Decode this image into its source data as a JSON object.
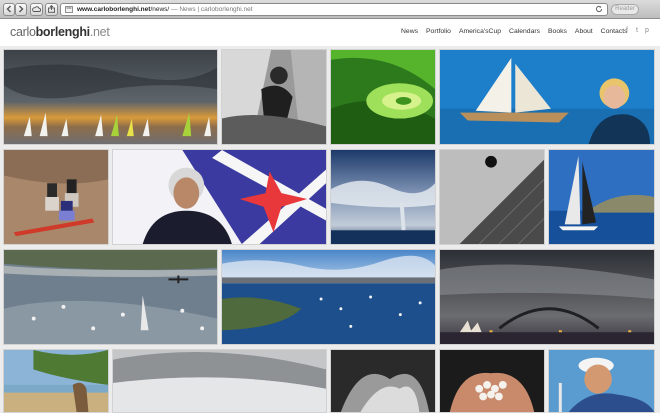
{
  "browser": {
    "url_host": "www.carloborlenghi.net",
    "url_path": "/news/",
    "url_title": " — News | carloborlenghi.net",
    "reader_label": "Reader"
  },
  "site": {
    "logo_light": "carlo",
    "logo_bold": "borlenghi",
    "logo_tld": ".net",
    "nav": [
      "News",
      "Portfolio",
      "America'sCup",
      "Calendars",
      "Books",
      "About",
      "Contacts"
    ],
    "social": [
      "f",
      "t",
      "p"
    ]
  },
  "icons": [
    "back-arrow-icon",
    "forward-arrow-icon",
    "cloud-icon",
    "share-icon",
    "site-favicon-icon",
    "reload-icon",
    "facebook-icon",
    "twitter-icon",
    "pinterest-icon"
  ],
  "photos": [
    "regatta-sunset",
    "sailor-bw",
    "green-abstract",
    "model-sailboat",
    "ink-bottles",
    "portrait-flag",
    "waterspout",
    "sail-detail-bw",
    "sailboat-island",
    "harbour-race-aerial",
    "sydney-harbour",
    "sydney-opera-storm",
    "kangaroo-beach",
    "wave-curl",
    "splash-bw",
    "pearls-hands",
    "sailor-smiling"
  ]
}
